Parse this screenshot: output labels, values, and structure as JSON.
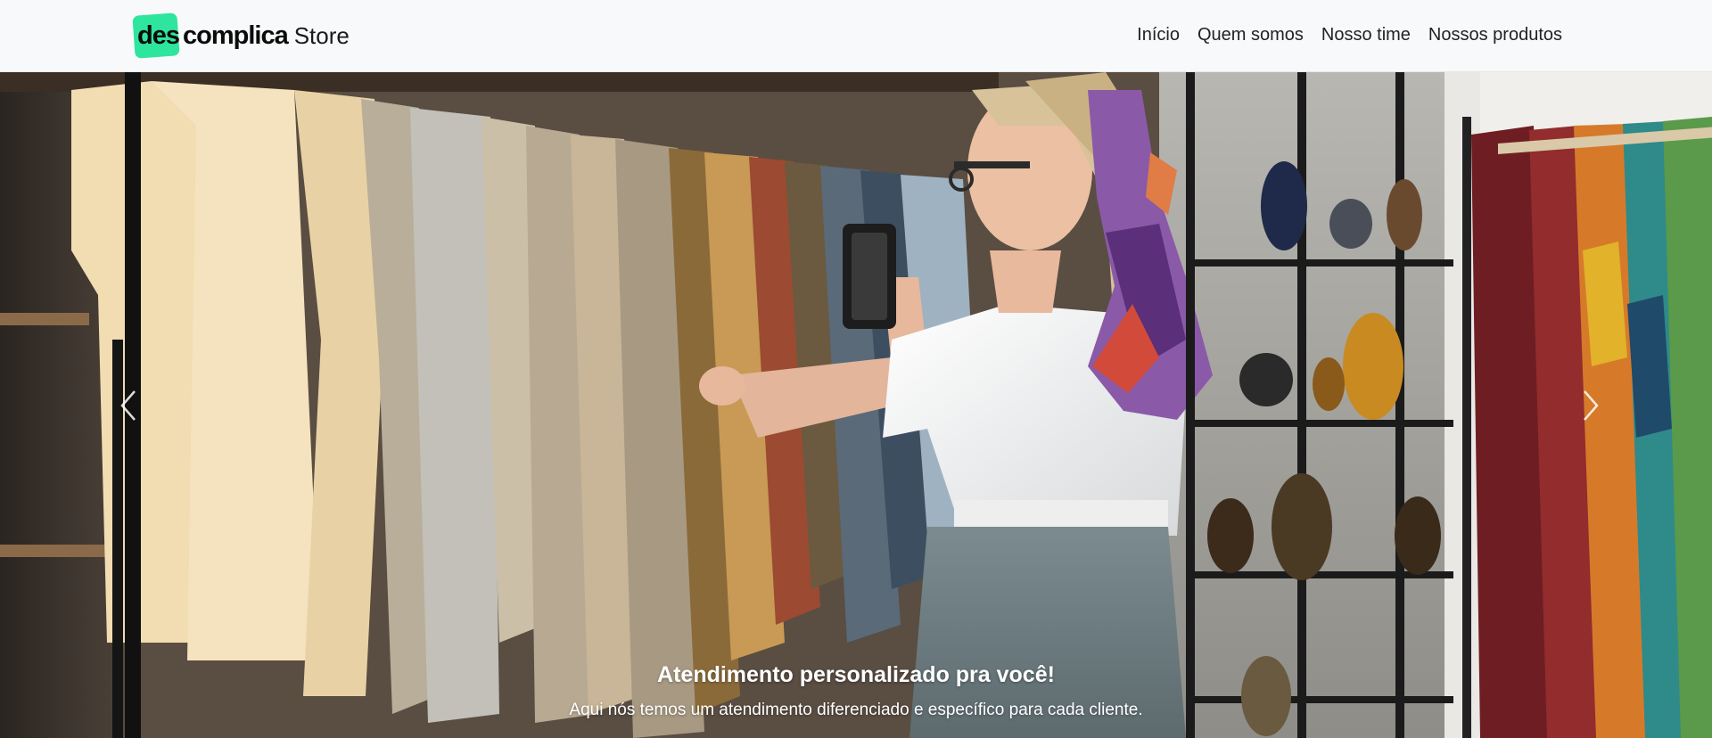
{
  "brand": {
    "logo_part1": "des",
    "logo_part2": "complica",
    "logo_part3": "Store",
    "accent_color": "#2ee59d"
  },
  "nav": {
    "items": [
      {
        "label": "Início"
      },
      {
        "label": "Quem somos"
      },
      {
        "label": "Nosso time"
      },
      {
        "label": "Nossos produtos"
      }
    ]
  },
  "carousel": {
    "slide": {
      "title": "Atendimento personalizado pra você!",
      "text": "Aqui nós temos um atendimento diferenciado e específico para cada cliente."
    },
    "prev_icon": "chevron-left-icon",
    "next_icon": "chevron-right-icon"
  }
}
